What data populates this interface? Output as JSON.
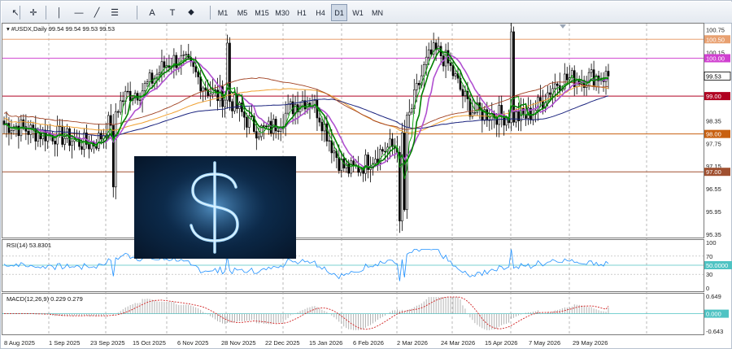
{
  "toolbar": {
    "tools": [
      {
        "name": "cursor-icon",
        "glyph": "↖"
      },
      {
        "name": "crosshair-icon",
        "glyph": "✛"
      },
      {
        "name": "vertical-line-icon",
        "glyph": "│"
      },
      {
        "name": "horizontal-line-icon",
        "glyph": "—"
      },
      {
        "name": "trend-line-icon",
        "glyph": "╱"
      },
      {
        "name": "fibonacci-icon",
        "glyph": "☰"
      },
      {
        "name": "text-icon",
        "glyph": "A"
      },
      {
        "name": "text-label-icon",
        "glyph": "T"
      },
      {
        "name": "shapes-icon",
        "glyph": "⬥"
      }
    ],
    "timeframes": [
      "M1",
      "M5",
      "M15",
      "M30",
      "H1",
      "H4",
      "D1",
      "W1",
      "MN"
    ],
    "active_timeframe": "D1"
  },
  "chart": {
    "header": "#USDX,Daily  99.54 99.54 99.53 99.53",
    "price_labels": [
      "100.75",
      "100.50",
      "100.15",
      "100.00",
      "99.53",
      "99.00",
      "98.35",
      "98.00",
      "97.75",
      "97.15",
      "97.00",
      "96.55",
      "95.95",
      "95.35"
    ],
    "level_tags": [
      {
        "text": "100.50",
        "color": "#e8a070"
      },
      {
        "text": "100.00",
        "color": "#d040d0"
      },
      {
        "text": "99.00",
        "color": "#b00020"
      },
      {
        "text": "98.00",
        "color": "#c86010"
      },
      {
        "text": "97.00",
        "color": "#a05030"
      }
    ],
    "current_price": "99.53",
    "date_labels": [
      "8 Aug 2025",
      "1 Sep 2025",
      "23 Sep 2025",
      "15 Oct 2025",
      "6 Nov 2025",
      "28 Nov 2025",
      "22 Dec 2025",
      "15 Jan 2026",
      "6 Feb 2026",
      "2 Mar 2026",
      "24 Mar 2026",
      "15 Apr 2026",
      "7 May 2026",
      "29 May 2026"
    ],
    "colors": {
      "candles": "#000000",
      "ma_fast": "#00a000",
      "ma_mid": "#008000",
      "ma_violet": "#b050d0",
      "ma_navy": "#1a237e",
      "ma_brown": "#a04020",
      "ma_orange": "#f0a030"
    }
  },
  "rsi": {
    "header": "RSI(14) 53.8301",
    "labels": [
      "100",
      "70",
      "50.0000",
      "30",
      "0"
    ],
    "line_color": "#1e90ff"
  },
  "macd": {
    "header": "MACD(12,26,9) 0.229 0.279",
    "labels": [
      "0.649",
      "0.000",
      "-0.643"
    ]
  },
  "image": {
    "icon": "dollar-sign-icon"
  },
  "chart_data": {
    "type": "candlestick",
    "symbol": "#USDX",
    "timeframe": "Daily",
    "ohlc_last": {
      "open": 99.54,
      "high": 99.54,
      "low": 99.53,
      "close": 99.53
    },
    "ylim": [
      95.35,
      100.85
    ],
    "levels": [
      100.5,
      100.0,
      99.0,
      98.0,
      97.0
    ],
    "close_series": [
      {
        "date": "8 Aug 2025",
        "close": 98.25
      },
      {
        "date": "1 Sep 2025",
        "close": 98.0
      },
      {
        "date": "23 Sep 2025",
        "close": 97.75
      },
      {
        "date": "15 Oct 2025",
        "close": 99.1
      },
      {
        "date": "6 Nov 2025",
        "close": 99.95
      },
      {
        "date": "28 Nov 2025",
        "close": 99.0
      },
      {
        "date": "22 Dec 2025",
        "close": 98.1
      },
      {
        "date": "15 Jan 2026",
        "close": 98.9
      },
      {
        "date": "6 Feb 2026",
        "close": 97.05
      },
      {
        "date": "2 Mar 2026",
        "close": 97.65
      },
      {
        "date": "24 Mar 2026",
        "close": 100.15
      },
      {
        "date": "15 Apr 2026",
        "close": 98.55
      },
      {
        "date": "7 May 2026",
        "close": 98.45
      },
      {
        "date": "29 May 2026",
        "close": 99.45
      },
      {
        "date": "now",
        "close": 99.53
      }
    ],
    "rsi_last": 53.8301,
    "rsi_levels": [
      70,
      50,
      30
    ],
    "macd": {
      "main": 0.229,
      "signal": 0.279,
      "range": [
        -0.643,
        0.649
      ]
    }
  }
}
